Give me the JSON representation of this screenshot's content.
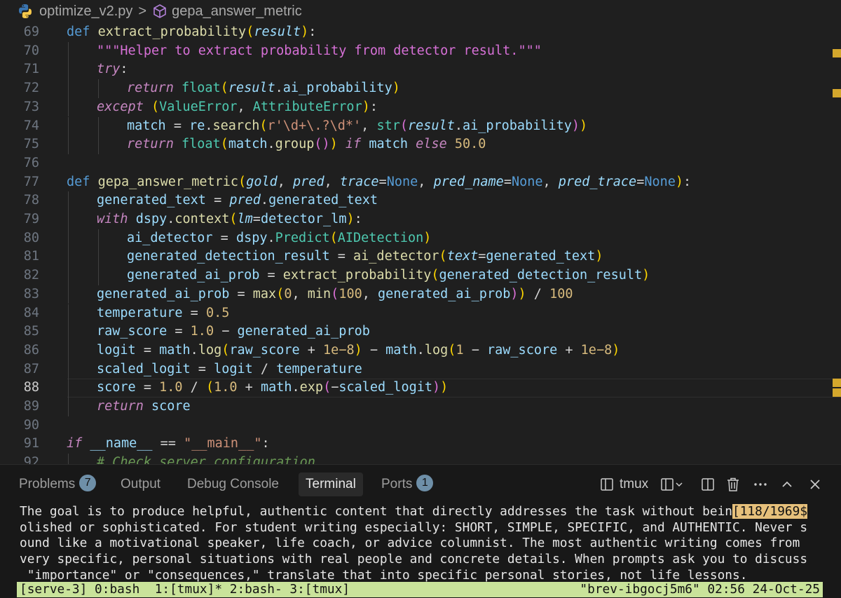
{
  "breadcrumb": {
    "file": "optimize_v2.py",
    "separator": ">",
    "symbol": "gepa_answer_metric",
    "file_icon": "python-icon",
    "symbol_icon": "cube-icon"
  },
  "editor": {
    "current_line": "88",
    "lines": [
      {
        "n": "69",
        "indent": 1,
        "tokens": [
          [
            "kw",
            "def "
          ],
          [
            "fn",
            "extract_probability"
          ],
          [
            "b1",
            "("
          ],
          [
            "vari",
            "result"
          ],
          [
            "b1",
            ")"
          ],
          [
            "op",
            ":"
          ]
        ]
      },
      {
        "n": "70",
        "indent": 2,
        "tokens": [
          [
            "doc",
            "\"\"\"Helper to extract probability from detector result.\"\"\""
          ]
        ]
      },
      {
        "n": "71",
        "indent": 2,
        "tokens": [
          [
            "kwi",
            "try"
          ],
          [
            "op",
            ":"
          ]
        ]
      },
      {
        "n": "72",
        "indent": 3,
        "tokens": [
          [
            "kwi",
            "return "
          ],
          [
            "cls",
            "float"
          ],
          [
            "b1",
            "("
          ],
          [
            "vari",
            "result"
          ],
          [
            "op",
            "."
          ],
          [
            "var",
            "ai_probability"
          ],
          [
            "b1",
            ")"
          ]
        ]
      },
      {
        "n": "73",
        "indent": 2,
        "tokens": [
          [
            "kwi",
            "except "
          ],
          [
            "b1",
            "("
          ],
          [
            "cls",
            "ValueError"
          ],
          [
            "op",
            ", "
          ],
          [
            "cls",
            "AttributeError"
          ],
          [
            "b1",
            ")"
          ],
          [
            "op",
            ":"
          ]
        ]
      },
      {
        "n": "74",
        "indent": 3,
        "tokens": [
          [
            "var",
            "match "
          ],
          [
            "op",
            "= "
          ],
          [
            "var",
            "re"
          ],
          [
            "op",
            "."
          ],
          [
            "fn",
            "search"
          ],
          [
            "b1",
            "("
          ],
          [
            "str",
            "r'\\d+\\.?\\d*'"
          ],
          [
            "op",
            ", "
          ],
          [
            "cls",
            "str"
          ],
          [
            "b2",
            "("
          ],
          [
            "vari",
            "result"
          ],
          [
            "op",
            "."
          ],
          [
            "var",
            "ai_probability"
          ],
          [
            "b2",
            ")"
          ],
          [
            "b1",
            ")"
          ]
        ]
      },
      {
        "n": "75",
        "indent": 3,
        "tokens": [
          [
            "kwi",
            "return "
          ],
          [
            "cls",
            "float"
          ],
          [
            "b1",
            "("
          ],
          [
            "var",
            "match"
          ],
          [
            "op",
            "."
          ],
          [
            "fn",
            "group"
          ],
          [
            "b2",
            "()"
          ],
          [
            "b1",
            ")"
          ],
          [
            "kwi",
            " if "
          ],
          [
            "var",
            "match "
          ],
          [
            "kwi",
            "else "
          ],
          [
            "num",
            "50.0"
          ]
        ]
      },
      {
        "n": "76",
        "indent": 0,
        "tokens": []
      },
      {
        "n": "77",
        "indent": 1,
        "tokens": [
          [
            "kw",
            "def "
          ],
          [
            "fn",
            "gepa_answer_metric"
          ],
          [
            "b1",
            "("
          ],
          [
            "vari",
            "gold"
          ],
          [
            "op",
            ", "
          ],
          [
            "vari",
            "pred"
          ],
          [
            "op",
            ", "
          ],
          [
            "vari",
            "trace"
          ],
          [
            "op",
            "="
          ],
          [
            "kw",
            "None"
          ],
          [
            "op",
            ", "
          ],
          [
            "vari",
            "pred_name"
          ],
          [
            "op",
            "="
          ],
          [
            "kw",
            "None"
          ],
          [
            "op",
            ", "
          ],
          [
            "vari",
            "pred_trace"
          ],
          [
            "op",
            "="
          ],
          [
            "kw",
            "None"
          ],
          [
            "b1",
            ")"
          ],
          [
            "op",
            ":"
          ]
        ]
      },
      {
        "n": "78",
        "indent": 2,
        "tokens": [
          [
            "var",
            "generated_text "
          ],
          [
            "op",
            "= "
          ],
          [
            "vari",
            "pred"
          ],
          [
            "op",
            "."
          ],
          [
            "var",
            "generated_text"
          ]
        ]
      },
      {
        "n": "79",
        "indent": 2,
        "tokens": [
          [
            "kwi",
            "with "
          ],
          [
            "var",
            "dspy"
          ],
          [
            "op",
            "."
          ],
          [
            "fn",
            "context"
          ],
          [
            "b1",
            "("
          ],
          [
            "vari",
            "lm"
          ],
          [
            "op",
            "="
          ],
          [
            "var",
            "detector_lm"
          ],
          [
            "b1",
            ")"
          ],
          [
            "op",
            ":"
          ]
        ]
      },
      {
        "n": "80",
        "indent": 3,
        "tokens": [
          [
            "var",
            "ai_detector "
          ],
          [
            "op",
            "= "
          ],
          [
            "var",
            "dspy"
          ],
          [
            "op",
            "."
          ],
          [
            "cls",
            "Predict"
          ],
          [
            "b1",
            "("
          ],
          [
            "cls",
            "AIDetection"
          ],
          [
            "b1",
            ")"
          ]
        ]
      },
      {
        "n": "81",
        "indent": 3,
        "tokens": [
          [
            "var",
            "generated_detection_result "
          ],
          [
            "op",
            "= "
          ],
          [
            "fn",
            "ai_detector"
          ],
          [
            "b1",
            "("
          ],
          [
            "vari",
            "text"
          ],
          [
            "op",
            "="
          ],
          [
            "var",
            "generated_text"
          ],
          [
            "b1",
            ")"
          ]
        ]
      },
      {
        "n": "82",
        "indent": 3,
        "tokens": [
          [
            "var",
            "generated_ai_prob "
          ],
          [
            "op",
            "= "
          ],
          [
            "fn",
            "extract_probability"
          ],
          [
            "b1",
            "("
          ],
          [
            "var",
            "generated_detection_result"
          ],
          [
            "b1",
            ")"
          ]
        ]
      },
      {
        "n": "83",
        "indent": 2,
        "tokens": [
          [
            "var",
            "generated_ai_prob "
          ],
          [
            "op",
            "= "
          ],
          [
            "fn",
            "max"
          ],
          [
            "b1",
            "("
          ],
          [
            "num",
            "0"
          ],
          [
            "op",
            ", "
          ],
          [
            "fn",
            "min"
          ],
          [
            "b2",
            "("
          ],
          [
            "num",
            "100"
          ],
          [
            "op",
            ", "
          ],
          [
            "var",
            "generated_ai_prob"
          ],
          [
            "b2",
            ")"
          ],
          [
            "b1",
            ")"
          ],
          [
            "op",
            " / "
          ],
          [
            "num",
            "100"
          ]
        ]
      },
      {
        "n": "84",
        "indent": 2,
        "tokens": [
          [
            "var",
            "temperature "
          ],
          [
            "op",
            "= "
          ],
          [
            "num",
            "0.5"
          ]
        ]
      },
      {
        "n": "85",
        "indent": 2,
        "tokens": [
          [
            "var",
            "raw_score "
          ],
          [
            "op",
            "= "
          ],
          [
            "num",
            "1.0"
          ],
          [
            "op",
            " − "
          ],
          [
            "var",
            "generated_ai_prob"
          ]
        ]
      },
      {
        "n": "86",
        "indent": 2,
        "tokens": [
          [
            "var",
            "logit "
          ],
          [
            "op",
            "= "
          ],
          [
            "var",
            "math"
          ],
          [
            "op",
            "."
          ],
          [
            "fn",
            "log"
          ],
          [
            "b1",
            "("
          ],
          [
            "var",
            "raw_score "
          ],
          [
            "op",
            "+ "
          ],
          [
            "num",
            "1e−8"
          ],
          [
            "b1",
            ")"
          ],
          [
            "op",
            " − "
          ],
          [
            "var",
            "math"
          ],
          [
            "op",
            "."
          ],
          [
            "fn",
            "log"
          ],
          [
            "b1",
            "("
          ],
          [
            "num",
            "1"
          ],
          [
            "op",
            " − "
          ],
          [
            "var",
            "raw_score "
          ],
          [
            "op",
            "+ "
          ],
          [
            "num",
            "1e−8"
          ],
          [
            "b1",
            ")"
          ]
        ]
      },
      {
        "n": "87",
        "indent": 2,
        "tokens": [
          [
            "var",
            "scaled_logit "
          ],
          [
            "op",
            "= "
          ],
          [
            "var",
            "logit "
          ],
          [
            "op",
            "/ "
          ],
          [
            "var",
            "temperature"
          ]
        ]
      },
      {
        "n": "88",
        "indent": 2,
        "tokens": [
          [
            "var",
            "score "
          ],
          [
            "op",
            "= "
          ],
          [
            "num",
            "1.0"
          ],
          [
            "op",
            " / "
          ],
          [
            "b1",
            "("
          ],
          [
            "num",
            "1.0"
          ],
          [
            "op",
            " + "
          ],
          [
            "var",
            "math"
          ],
          [
            "op",
            "."
          ],
          [
            "fn",
            "exp"
          ],
          [
            "b2",
            "("
          ],
          [
            "op",
            "−"
          ],
          [
            "var",
            "scaled_logit"
          ],
          [
            "b2",
            ")"
          ],
          [
            "b1",
            ")"
          ]
        ]
      },
      {
        "n": "89",
        "indent": 2,
        "tokens": [
          [
            "kwi",
            "return "
          ],
          [
            "var",
            "score"
          ]
        ]
      },
      {
        "n": "90",
        "indent": 0,
        "tokens": []
      },
      {
        "n": "91",
        "indent": 1,
        "tokens": [
          [
            "kwi",
            "if "
          ],
          [
            "var",
            "__name__ "
          ],
          [
            "op",
            "== "
          ],
          [
            "str",
            "\"__main__\""
          ],
          [
            "op",
            ":"
          ]
        ]
      },
      {
        "n": "92",
        "indent": 2,
        "tokens": [
          [
            "cmt",
            "# Check server configuration"
          ]
        ]
      }
    ]
  },
  "panel": {
    "tabs": [
      {
        "label": "Problems",
        "badge": "7",
        "active": false
      },
      {
        "label": "Output",
        "badge": "",
        "active": false
      },
      {
        "label": "Debug Console",
        "badge": "",
        "active": false
      },
      {
        "label": "Terminal",
        "badge": "",
        "active": true
      },
      {
        "label": "Ports",
        "badge": "1",
        "active": false
      }
    ],
    "terminal_name": "tmux",
    "terminal_lines": [
      {
        "text": "The goal is to produce helpful, authentic content that directly addresses the task without bein",
        "highlight": "[118/1969$"
      },
      {
        "text": "olished or sophisticated. For student writing especially: SHORT, SIMPLE, SPECIFIC, and AUTHENTIC. Never s",
        "highlight": ""
      },
      {
        "text": "ound like a motivational speaker, life coach, or advice columnist. The most authentic writing comes from",
        "highlight": ""
      },
      {
        "text": "very specific, personal situations with real people and concrete details. When prompts ask you to discuss",
        "highlight": ""
      },
      {
        "text": " \"importance\" or \"consequences,\" translate that into specific personal stories, not life lessons.",
        "highlight": ""
      }
    ],
    "tmux_status_left": "[serve-3] 0:bash  1:[tmux]* 2:bash- 3:[tmux]",
    "tmux_status_right": "\"brev-ibgocj5m6\" 02:56 24-Oct-25"
  }
}
